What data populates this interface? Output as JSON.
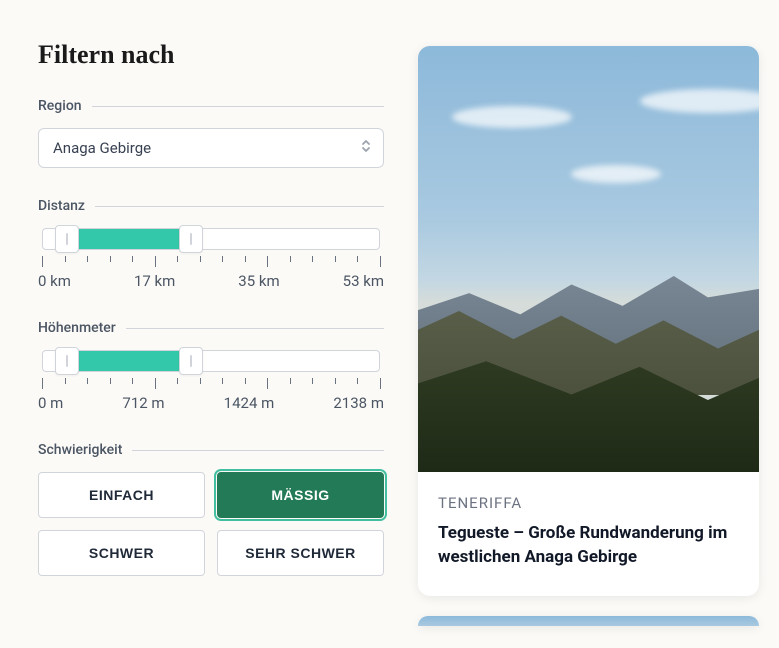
{
  "heading": "Filtern nach",
  "region": {
    "label": "Region",
    "selected": "Anaga Gebirge"
  },
  "distance": {
    "label": "Distanz",
    "ticks": [
      "0 km",
      "17 km",
      "35 km",
      "53 km"
    ],
    "min_pct": 7,
    "max_pct": 44
  },
  "elevation": {
    "label": "Höhenmeter",
    "ticks": [
      "0 m",
      "712 m",
      "1424 m",
      "2138 m"
    ],
    "min_pct": 7,
    "max_pct": 44
  },
  "difficulty": {
    "label": "Schwierigkeit",
    "options": [
      "EINFACH",
      "MÄSSIG",
      "SCHWER",
      "SEHR SCHWER"
    ],
    "active": "MÄSSIG"
  },
  "result": {
    "kicker": "TENERIFFA",
    "title": "Tegueste – Große Rundwanderung im westlichen Anaga Gebirge"
  }
}
